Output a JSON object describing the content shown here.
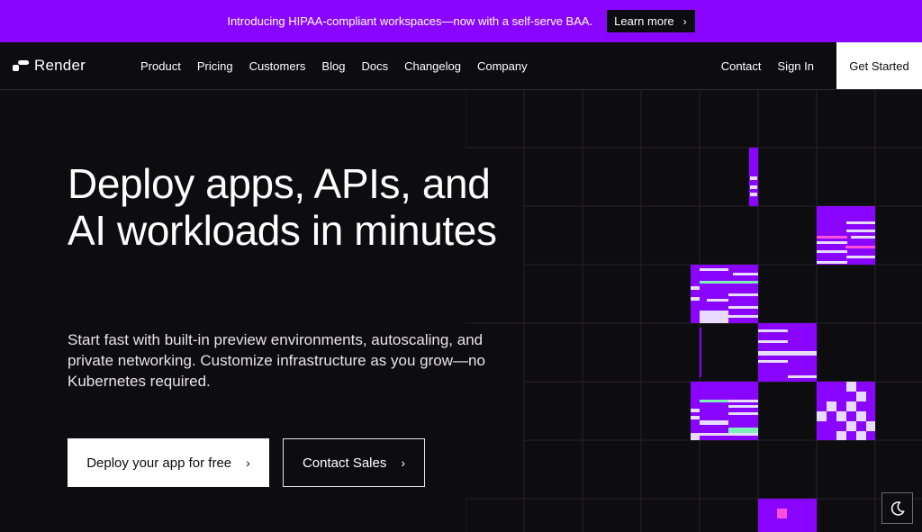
{
  "announcement": {
    "text": "Introducing HIPAA-compliant workspaces—now with a self-serve BAA.",
    "cta_label": "Learn more",
    "background": "#8a05ff"
  },
  "nav": {
    "brand": "Render",
    "links": [
      "Product",
      "Pricing",
      "Customers",
      "Blog",
      "Docs",
      "Changelog",
      "Company"
    ],
    "contact": "Contact",
    "sign_in": "Sign In",
    "get_started": "Get Started"
  },
  "hero": {
    "title": "Deploy apps, APIs, and AI workloads in minutes",
    "subtitle": "Start fast with built-in preview environments, autoscaling, and private networking. Customize infrastructure as you grow—no Kubernetes required.",
    "primary_cta": "Deploy your app for free",
    "secondary_cta": "Contact Sales"
  },
  "theme_toggle": {
    "icon": "moon-icon"
  },
  "colors": {
    "accent": "#8a05ff",
    "background": "#0d0c0f",
    "tile_light": "#e7dcff",
    "tile_green": "#7cf0b8",
    "tile_pink": "#ff4fd8"
  }
}
